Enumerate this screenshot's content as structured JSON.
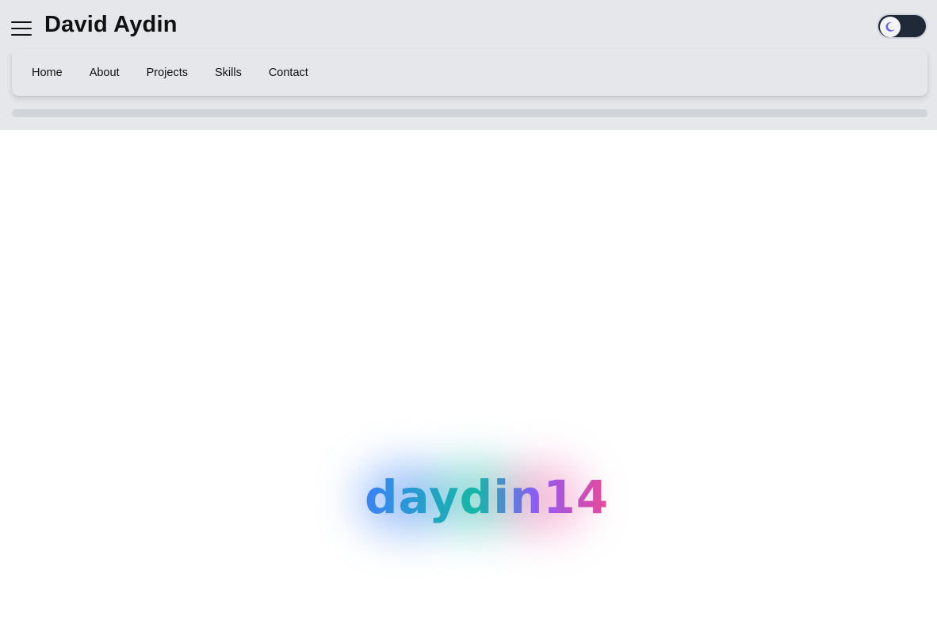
{
  "header": {
    "title": "David Aydin",
    "menu_icon": "hamburger-menu-icon",
    "theme_toggle": {
      "icon": "moon-icon",
      "state": "dark-mode-off",
      "accent": "#6366f1"
    }
  },
  "nav": {
    "items": [
      {
        "label": "Home"
      },
      {
        "label": "About"
      },
      {
        "label": "Projects"
      },
      {
        "label": "Skills"
      },
      {
        "label": "Contact"
      }
    ]
  },
  "scroll_progress": {
    "value": 0
  },
  "hero": {
    "logo_text": "daydin14",
    "gradient_colors": [
      "#3b82f6",
      "#14b8a6",
      "#8b5cf6",
      "#ec4899"
    ]
  }
}
